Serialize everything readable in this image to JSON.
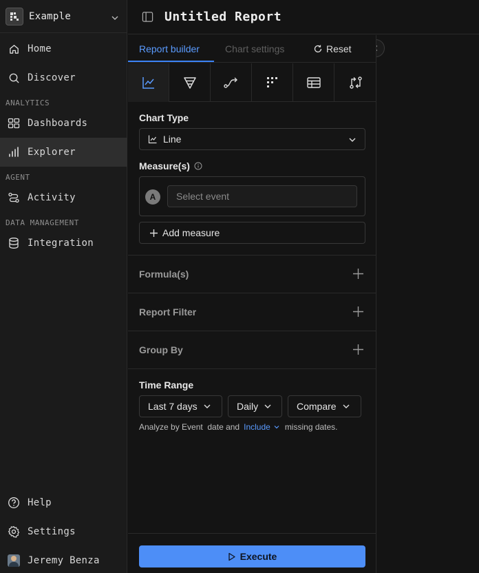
{
  "workspace": {
    "name": "Example"
  },
  "sidebar": {
    "nav_main": [
      {
        "label": "Home",
        "icon": "home-icon"
      },
      {
        "label": "Discover",
        "icon": "search-icon"
      }
    ],
    "section_analytics": "ANALYTICS",
    "analytics_items": [
      {
        "label": "Dashboards",
        "icon": "dashboard-icon"
      },
      {
        "label": "Explorer",
        "icon": "bar-chart-icon",
        "active": true
      }
    ],
    "section_agent": "AGENT",
    "agent_items": [
      {
        "label": "Activity",
        "icon": "activity-icon"
      }
    ],
    "section_data": "DATA MANAGEMENT",
    "data_items": [
      {
        "label": "Integration",
        "icon": "database-icon"
      }
    ],
    "bottom_items": [
      {
        "label": "Help",
        "icon": "help-icon"
      },
      {
        "label": "Settings",
        "icon": "gear-icon"
      }
    ],
    "user": {
      "name": "Jeremy Benza"
    }
  },
  "header": {
    "title": "Untitled Report"
  },
  "builder": {
    "tabs": {
      "report_builder": "Report builder",
      "chart_settings": "Chart settings",
      "reset": "Reset"
    },
    "chart_type_label": "Chart Type",
    "chart_type_value": "Line",
    "measures_label": "Measure(s)",
    "measure_badge": "A",
    "event_placeholder": "Select event",
    "add_measure": "Add measure",
    "formulas": "Formula(s)",
    "report_filter": "Report Filter",
    "group_by": "Group By",
    "time_range_label": "Time Range",
    "time_range": "Last 7 days",
    "granularity": "Daily",
    "compare": "Compare",
    "analyze_prefix": "Analyze by Event  date and",
    "include": "Include",
    "analyze_suffix": "missing dates.",
    "execute": "Execute"
  },
  "colors": {
    "accent": "#4d8ef7",
    "link": "#5a9bff",
    "background": "#141414",
    "sidebar": "#1b1b1b"
  }
}
